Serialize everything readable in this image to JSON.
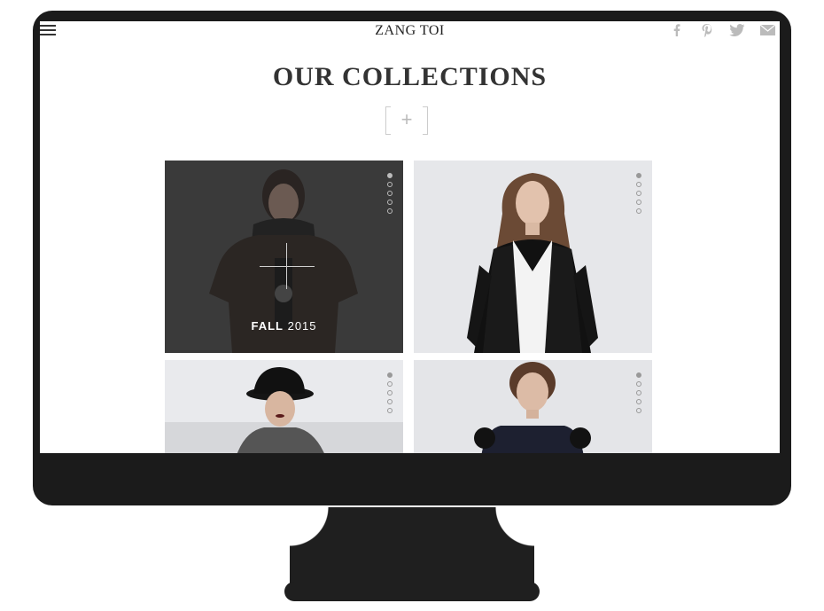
{
  "header": {
    "brand": "ZANG TOI",
    "social": [
      "facebook-icon",
      "pinterest-icon",
      "twitter-icon",
      "mail-icon"
    ]
  },
  "main": {
    "title": "OUR COLLECTIONS",
    "expand_symbol": "+"
  },
  "collections": [
    {
      "label_bold": "FALL",
      "label_rest": "2015",
      "active": true
    },
    {
      "label_bold": "",
      "label_rest": "",
      "active": false
    },
    {
      "label_bold": "",
      "label_rest": "",
      "active": false
    },
    {
      "label_bold": "",
      "label_rest": "",
      "active": false
    }
  ],
  "colors": {
    "monitor": "#1b1b1b",
    "title": "#333333",
    "overlay": "#3c3c3c"
  }
}
